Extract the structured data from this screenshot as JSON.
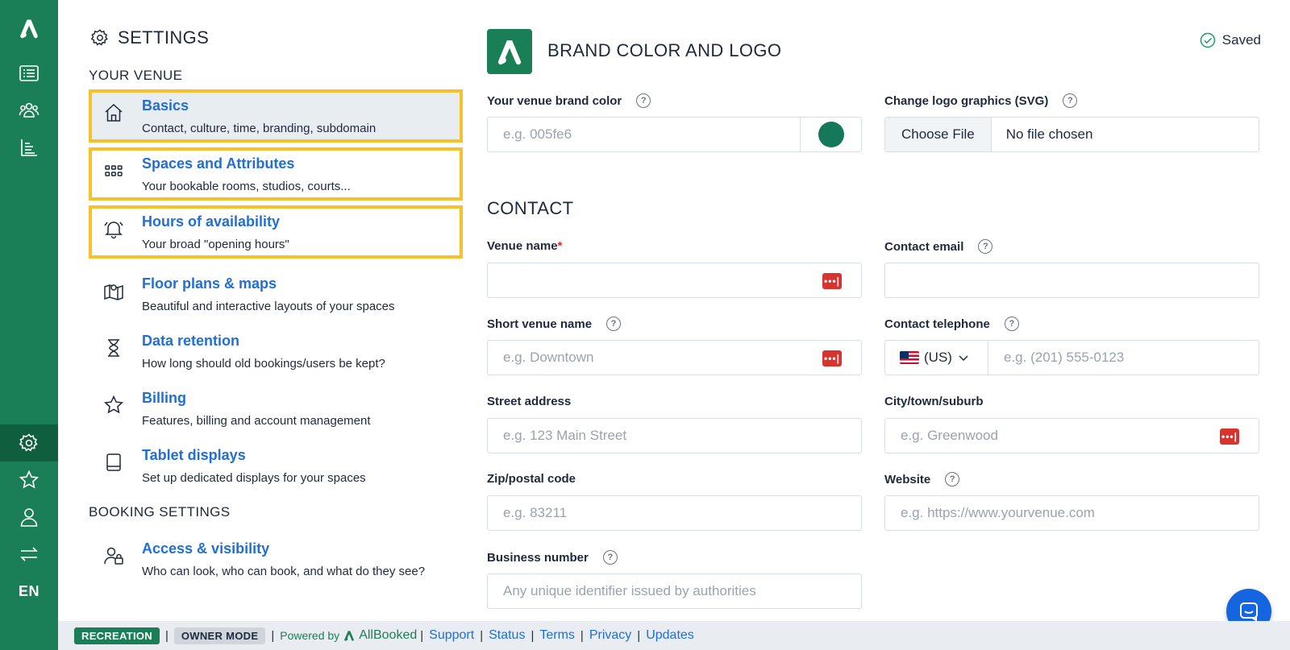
{
  "rail": {
    "lang": "EN",
    "icons": [
      "allbooked-logo-icon",
      "bookings-list-icon",
      "users-icon",
      "reports-icon",
      "settings-gear-icon",
      "star-icon",
      "user-icon",
      "switch-arrows-icon"
    ]
  },
  "settings": {
    "title": "SETTINGS",
    "your_venue_label": "YOUR VENUE",
    "booking_settings_label": "BOOKING SETTINGS",
    "items": [
      {
        "title": "Basics",
        "subtitle": "Contact, culture, time, branding, subdomain"
      },
      {
        "title": "Spaces and Attributes",
        "subtitle": "Your bookable rooms, studios, courts..."
      },
      {
        "title": "Hours of availability",
        "subtitle": "Your broad \"opening hours\""
      },
      {
        "title": "Floor plans & maps",
        "subtitle": "Beautiful and interactive layouts of your spaces"
      },
      {
        "title": "Data retention",
        "subtitle": "How long should old bookings/users be kept?"
      },
      {
        "title": "Billing",
        "subtitle": "Features, billing and account management"
      },
      {
        "title": "Tablet displays",
        "subtitle": "Set up dedicated displays for your spaces"
      },
      {
        "title": "Access & visibility",
        "subtitle": "Who can look, who can book, and what do they see?"
      }
    ]
  },
  "brand": {
    "title": "BRAND COLOR AND LOGO",
    "saved": "Saved",
    "color_label": "Your venue brand color",
    "color_placeholder": "e.g. 005fe6",
    "color_value_hex": "#15785a",
    "logo_label": "Change logo graphics (SVG)",
    "choose_file": "Choose File",
    "no_file": "No file chosen"
  },
  "contact": {
    "title": "CONTACT",
    "venue_name_label": "Venue name",
    "required_mark": "*",
    "contact_email_label": "Contact email",
    "short_name_label": "Short venue name",
    "short_name_placeholder": "e.g. Downtown",
    "telephone_label": "Contact telephone",
    "country": "(US)",
    "telephone_placeholder": "e.g. (201) 555-0123",
    "street_label": "Street address",
    "street_placeholder": "e.g. 123 Main Street",
    "city_label": "City/town/suburb",
    "city_placeholder": "e.g. Greenwood",
    "zip_label": "Zip/postal code",
    "zip_placeholder": "e.g. 83211",
    "website_label": "Website",
    "website_placeholder": "e.g. https://www.yourvenue.com",
    "business_label": "Business number",
    "business_placeholder": "Any unique identifier issued by authorities",
    "help_glyph": "?",
    "pwd_glyph": "•••|"
  },
  "footer": {
    "badge_recreation": "RECREATION",
    "badge_owner": "OWNER MODE",
    "separator": "|",
    "powered_by": "Powered by",
    "brand": "AllBooked",
    "links": [
      "Support",
      "Status",
      "Terms",
      "Privacy",
      "Updates"
    ]
  },
  "colors": {
    "rail_green": "#1a7f56",
    "highlight_yellow": "#f7c12b",
    "link_blue": "#1f6fd6",
    "chat_blue": "#1565e0"
  }
}
